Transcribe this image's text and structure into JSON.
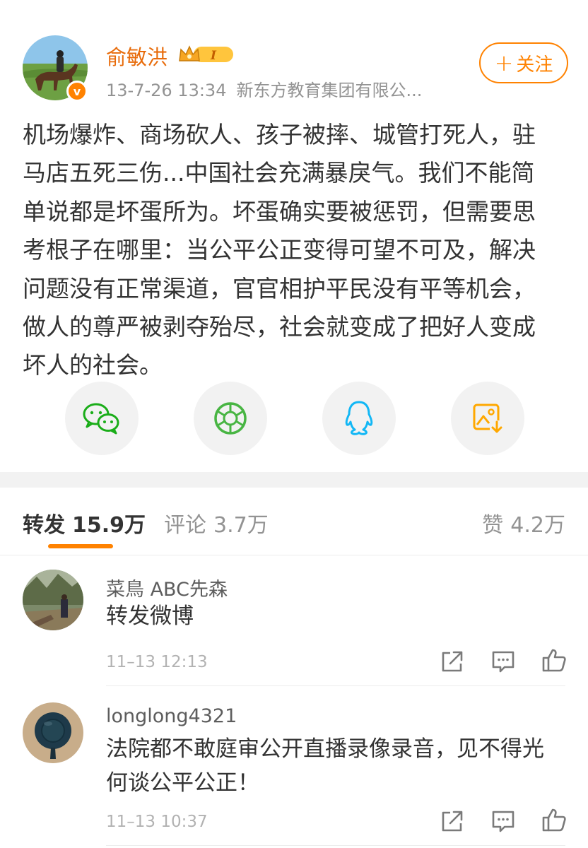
{
  "post": {
    "author_name": "俞敏洪",
    "vip_level": "I",
    "verified_badge": "v",
    "timestamp": "13-7-26 13:34",
    "source": "新东方教育集团有限公...",
    "follow_label": "关注",
    "follow_plus": "+",
    "text_lines": [
      "机场爆炸、商场砍人、孩子被摔、城管打死人，驻",
      "马店五死三伤...中国社会充满暴戾气。我们不能简",
      "单说都是坏蛋所为。坏蛋确实要被惩罚，但需要思",
      "考根子在哪里：当公平公正变得可望不可及，解决",
      "问题没有正常渠道，官官相护平民没有平等机会，",
      "做人的尊严被剥夺殆尽，社会就变成了把好人变成",
      "坏人的社会。"
    ]
  },
  "share_icons": [
    "wechat-icon",
    "moments-icon",
    "qq-icon",
    "save-image-icon"
  ],
  "tabs": {
    "forward_label": "转发",
    "forward_count": "15.9万",
    "comment_label": "评论",
    "comment_count": "3.7万",
    "like_label": "赞",
    "like_count": "4.2万"
  },
  "comments": [
    {
      "user": "菜鳥 ABC先森",
      "text_lines": [
        "转发微博"
      ],
      "time": "11–13 12:13"
    },
    {
      "user": "longlong4321",
      "text_lines": [
        "法院都不敢庭审公开直播录像录音，见不得光",
        "何谈公平公正！"
      ],
      "time": "11–13 10:37"
    }
  ],
  "colors": {
    "accent": "#ff8200",
    "author": "#e86b0a",
    "wechat": "#1aad19",
    "moments": "#48b543",
    "qq": "#12b7f5",
    "save": "#ffa800"
  }
}
